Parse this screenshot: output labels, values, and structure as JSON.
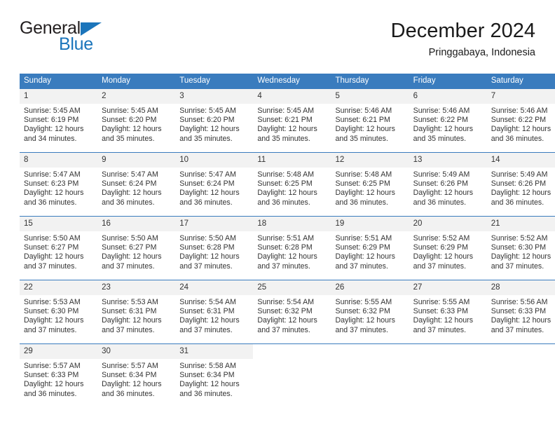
{
  "brand": {
    "name_top": "General",
    "name_bottom": "Blue",
    "triangle_color": "#1b75bb",
    "text_color": "#231f20"
  },
  "header": {
    "title": "December 2024",
    "subtitle": "Pringgabaya, Indonesia"
  },
  "theme": {
    "header_blue": "#3a7cbe",
    "daynum_band": "#f2f2f2",
    "text": "#333333"
  },
  "weekdays": [
    "Sunday",
    "Monday",
    "Tuesday",
    "Wednesday",
    "Thursday",
    "Friday",
    "Saturday"
  ],
  "labels": {
    "sunrise_prefix": "Sunrise:",
    "sunset_prefix": "Sunset:",
    "daylight_prefix": "Daylight:"
  },
  "weeks": [
    [
      {
        "day": "1",
        "sunrise": "Sunrise: 5:45 AM",
        "sunset": "Sunset: 6:19 PM",
        "daylight": "Daylight: 12 hours and 34 minutes."
      },
      {
        "day": "2",
        "sunrise": "Sunrise: 5:45 AM",
        "sunset": "Sunset: 6:20 PM",
        "daylight": "Daylight: 12 hours and 35 minutes."
      },
      {
        "day": "3",
        "sunrise": "Sunrise: 5:45 AM",
        "sunset": "Sunset: 6:20 PM",
        "daylight": "Daylight: 12 hours and 35 minutes."
      },
      {
        "day": "4",
        "sunrise": "Sunrise: 5:45 AM",
        "sunset": "Sunset: 6:21 PM",
        "daylight": "Daylight: 12 hours and 35 minutes."
      },
      {
        "day": "5",
        "sunrise": "Sunrise: 5:46 AM",
        "sunset": "Sunset: 6:21 PM",
        "daylight": "Daylight: 12 hours and 35 minutes."
      },
      {
        "day": "6",
        "sunrise": "Sunrise: 5:46 AM",
        "sunset": "Sunset: 6:22 PM",
        "daylight": "Daylight: 12 hours and 35 minutes."
      },
      {
        "day": "7",
        "sunrise": "Sunrise: 5:46 AM",
        "sunset": "Sunset: 6:22 PM",
        "daylight": "Daylight: 12 hours and 36 minutes."
      }
    ],
    [
      {
        "day": "8",
        "sunrise": "Sunrise: 5:47 AM",
        "sunset": "Sunset: 6:23 PM",
        "daylight": "Daylight: 12 hours and 36 minutes."
      },
      {
        "day": "9",
        "sunrise": "Sunrise: 5:47 AM",
        "sunset": "Sunset: 6:24 PM",
        "daylight": "Daylight: 12 hours and 36 minutes."
      },
      {
        "day": "10",
        "sunrise": "Sunrise: 5:47 AM",
        "sunset": "Sunset: 6:24 PM",
        "daylight": "Daylight: 12 hours and 36 minutes."
      },
      {
        "day": "11",
        "sunrise": "Sunrise: 5:48 AM",
        "sunset": "Sunset: 6:25 PM",
        "daylight": "Daylight: 12 hours and 36 minutes."
      },
      {
        "day": "12",
        "sunrise": "Sunrise: 5:48 AM",
        "sunset": "Sunset: 6:25 PM",
        "daylight": "Daylight: 12 hours and 36 minutes."
      },
      {
        "day": "13",
        "sunrise": "Sunrise: 5:49 AM",
        "sunset": "Sunset: 6:26 PM",
        "daylight": "Daylight: 12 hours and 36 minutes."
      },
      {
        "day": "14",
        "sunrise": "Sunrise: 5:49 AM",
        "sunset": "Sunset: 6:26 PM",
        "daylight": "Daylight: 12 hours and 36 minutes."
      }
    ],
    [
      {
        "day": "15",
        "sunrise": "Sunrise: 5:50 AM",
        "sunset": "Sunset: 6:27 PM",
        "daylight": "Daylight: 12 hours and 37 minutes."
      },
      {
        "day": "16",
        "sunrise": "Sunrise: 5:50 AM",
        "sunset": "Sunset: 6:27 PM",
        "daylight": "Daylight: 12 hours and 37 minutes."
      },
      {
        "day": "17",
        "sunrise": "Sunrise: 5:50 AM",
        "sunset": "Sunset: 6:28 PM",
        "daylight": "Daylight: 12 hours and 37 minutes."
      },
      {
        "day": "18",
        "sunrise": "Sunrise: 5:51 AM",
        "sunset": "Sunset: 6:28 PM",
        "daylight": "Daylight: 12 hours and 37 minutes."
      },
      {
        "day": "19",
        "sunrise": "Sunrise: 5:51 AM",
        "sunset": "Sunset: 6:29 PM",
        "daylight": "Daylight: 12 hours and 37 minutes."
      },
      {
        "day": "20",
        "sunrise": "Sunrise: 5:52 AM",
        "sunset": "Sunset: 6:29 PM",
        "daylight": "Daylight: 12 hours and 37 minutes."
      },
      {
        "day": "21",
        "sunrise": "Sunrise: 5:52 AM",
        "sunset": "Sunset: 6:30 PM",
        "daylight": "Daylight: 12 hours and 37 minutes."
      }
    ],
    [
      {
        "day": "22",
        "sunrise": "Sunrise: 5:53 AM",
        "sunset": "Sunset: 6:30 PM",
        "daylight": "Daylight: 12 hours and 37 minutes."
      },
      {
        "day": "23",
        "sunrise": "Sunrise: 5:53 AM",
        "sunset": "Sunset: 6:31 PM",
        "daylight": "Daylight: 12 hours and 37 minutes."
      },
      {
        "day": "24",
        "sunrise": "Sunrise: 5:54 AM",
        "sunset": "Sunset: 6:31 PM",
        "daylight": "Daylight: 12 hours and 37 minutes."
      },
      {
        "day": "25",
        "sunrise": "Sunrise: 5:54 AM",
        "sunset": "Sunset: 6:32 PM",
        "daylight": "Daylight: 12 hours and 37 minutes."
      },
      {
        "day": "26",
        "sunrise": "Sunrise: 5:55 AM",
        "sunset": "Sunset: 6:32 PM",
        "daylight": "Daylight: 12 hours and 37 minutes."
      },
      {
        "day": "27",
        "sunrise": "Sunrise: 5:55 AM",
        "sunset": "Sunset: 6:33 PM",
        "daylight": "Daylight: 12 hours and 37 minutes."
      },
      {
        "day": "28",
        "sunrise": "Sunrise: 5:56 AM",
        "sunset": "Sunset: 6:33 PM",
        "daylight": "Daylight: 12 hours and 37 minutes."
      }
    ],
    [
      {
        "day": "29",
        "sunrise": "Sunrise: 5:57 AM",
        "sunset": "Sunset: 6:33 PM",
        "daylight": "Daylight: 12 hours and 36 minutes."
      },
      {
        "day": "30",
        "sunrise": "Sunrise: 5:57 AM",
        "sunset": "Sunset: 6:34 PM",
        "daylight": "Daylight: 12 hours and 36 minutes."
      },
      {
        "day": "31",
        "sunrise": "Sunrise: 5:58 AM",
        "sunset": "Sunset: 6:34 PM",
        "daylight": "Daylight: 12 hours and 36 minutes."
      },
      {
        "day": "",
        "sunrise": "",
        "sunset": "",
        "daylight": ""
      },
      {
        "day": "",
        "sunrise": "",
        "sunset": "",
        "daylight": ""
      },
      {
        "day": "",
        "sunrise": "",
        "sunset": "",
        "daylight": ""
      },
      {
        "day": "",
        "sunrise": "",
        "sunset": "",
        "daylight": ""
      }
    ]
  ]
}
